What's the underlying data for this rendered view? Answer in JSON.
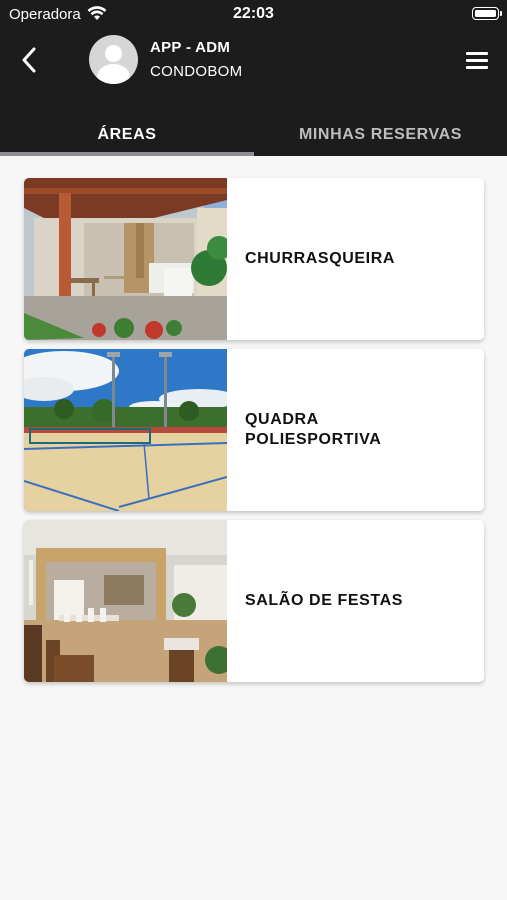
{
  "status_bar": {
    "carrier": "Operadora",
    "time": "22:03"
  },
  "header": {
    "user_name": "APP - ADM",
    "user_org": "CONDOBOM",
    "back_icon": "chevron-left-icon",
    "menu_icon": "hamburger-menu-icon"
  },
  "tabs": [
    {
      "label": "ÁREAS",
      "active": true
    },
    {
      "label": "MINHAS RESERVAS",
      "active": false
    }
  ],
  "areas": [
    {
      "name": "CHURRASQUEIRA"
    },
    {
      "name": "QUADRA POLIESPORTIVA"
    },
    {
      "name": "SALÃO DE FESTAS"
    }
  ],
  "colors": {
    "header_bg": "#1c1c1c",
    "tab_indicator": "#8e8e95",
    "page_bg": "#f7f7f7"
  }
}
